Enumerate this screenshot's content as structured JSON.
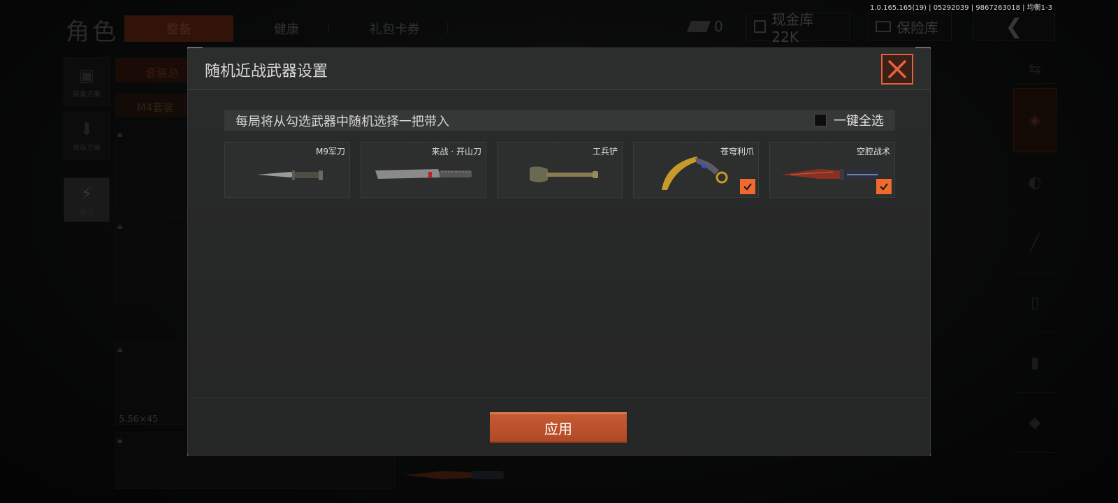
{
  "version_text": "1.0.165.165(19) | 05292039 | 9867263018 | 均衡1-3",
  "background": {
    "title": "角色",
    "tabs": [
      "整备",
      "健康",
      "礼包卡券"
    ],
    "currency_value": "0",
    "cash_label": "现金库 22K",
    "safe_label": "保险库",
    "side_buttons": [
      "装备方案",
      "保存方案",
      "能力"
    ],
    "loadout_label": "套装总",
    "preset_label": "M4套装",
    "ammo_label": "5.56×45"
  },
  "dialog": {
    "title": "随机近战武器设置",
    "info_text": "每局将从勾选武器中随机选择一把带入",
    "select_all_label": "一键全选",
    "select_all_checked": false,
    "weapons": [
      {
        "name": "M9军刀",
        "icon": "combat-knife-icon",
        "checked": false
      },
      {
        "name": "来战 · 开山刀",
        "icon": "machete-icon",
        "checked": false
      },
      {
        "name": "工兵铲",
        "icon": "shovel-icon",
        "checked": false
      },
      {
        "name": "苍穹利爪",
        "icon": "karambit-icon",
        "checked": true
      },
      {
        "name": "空腔战术",
        "icon": "tactical-knife-icon",
        "checked": true
      }
    ],
    "apply_label": "应用"
  },
  "colors": {
    "accent": "#ef6a2c",
    "apply_button": "#c05432",
    "close_border": "#e0643a"
  }
}
